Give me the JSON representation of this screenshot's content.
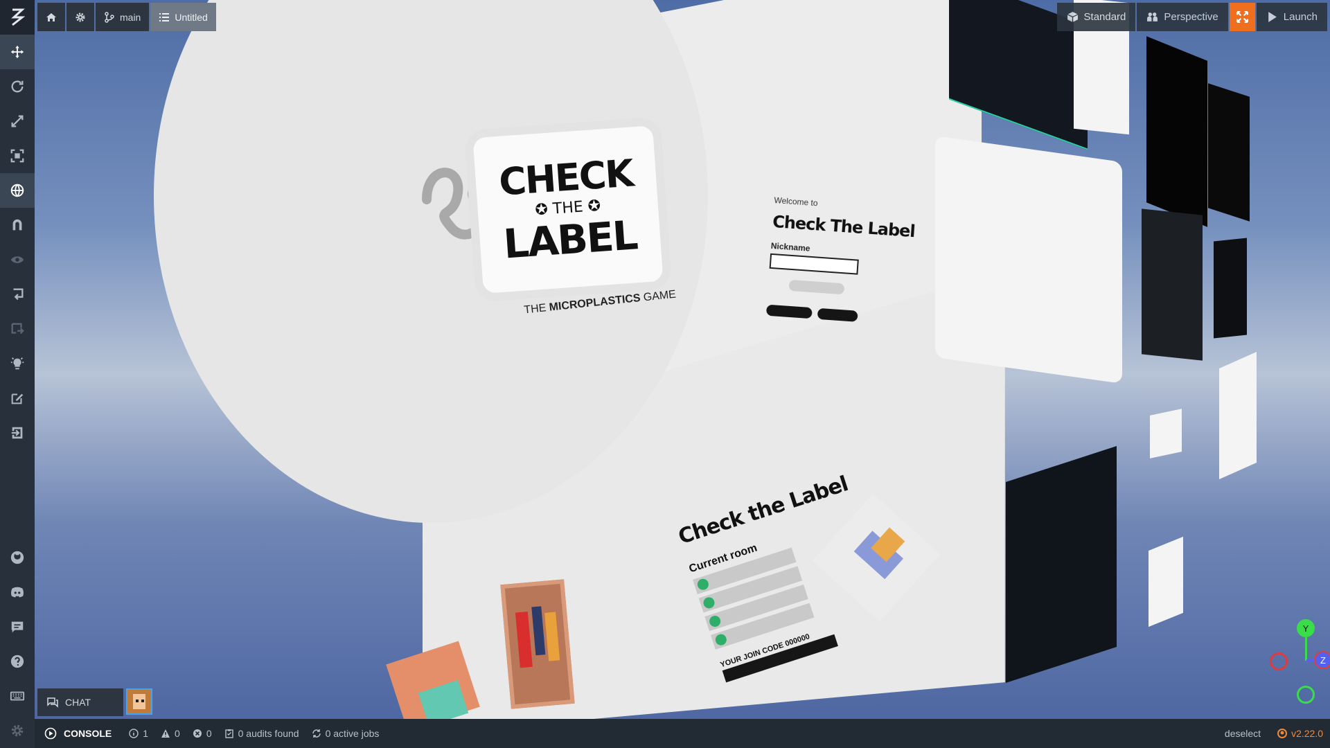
{
  "app": {
    "branch": "main",
    "project": "Untitled",
    "version": "v2.22.0"
  },
  "topright": {
    "standard": "Standard",
    "perspective": "Perspective",
    "launch": "Launch"
  },
  "scene": {
    "logo_check": "CHECK",
    "logo_the": "✪ THE ✪",
    "logo_label": "LABEL",
    "subtitle_pre": "THE ",
    "subtitle_bold": "MICROPLASTICS",
    "subtitle_post": " GAME",
    "welcome_small": "Welcome to",
    "welcome_title": "Check The Label",
    "nickname_label": "Nickname",
    "room_title": "Check the Label",
    "current_room": "Current room",
    "join_code": "YOUR JOIN CODE   000000"
  },
  "gizmo": {
    "y": "Y",
    "z": "Z"
  },
  "chat": {
    "label": "CHAT"
  },
  "bottom": {
    "console": "CONSOLE",
    "info_count": "1",
    "warn_count": "0",
    "error_count": "0",
    "audits": "0 audits found",
    "jobs": "0 active jobs",
    "deselect": "deselect"
  }
}
